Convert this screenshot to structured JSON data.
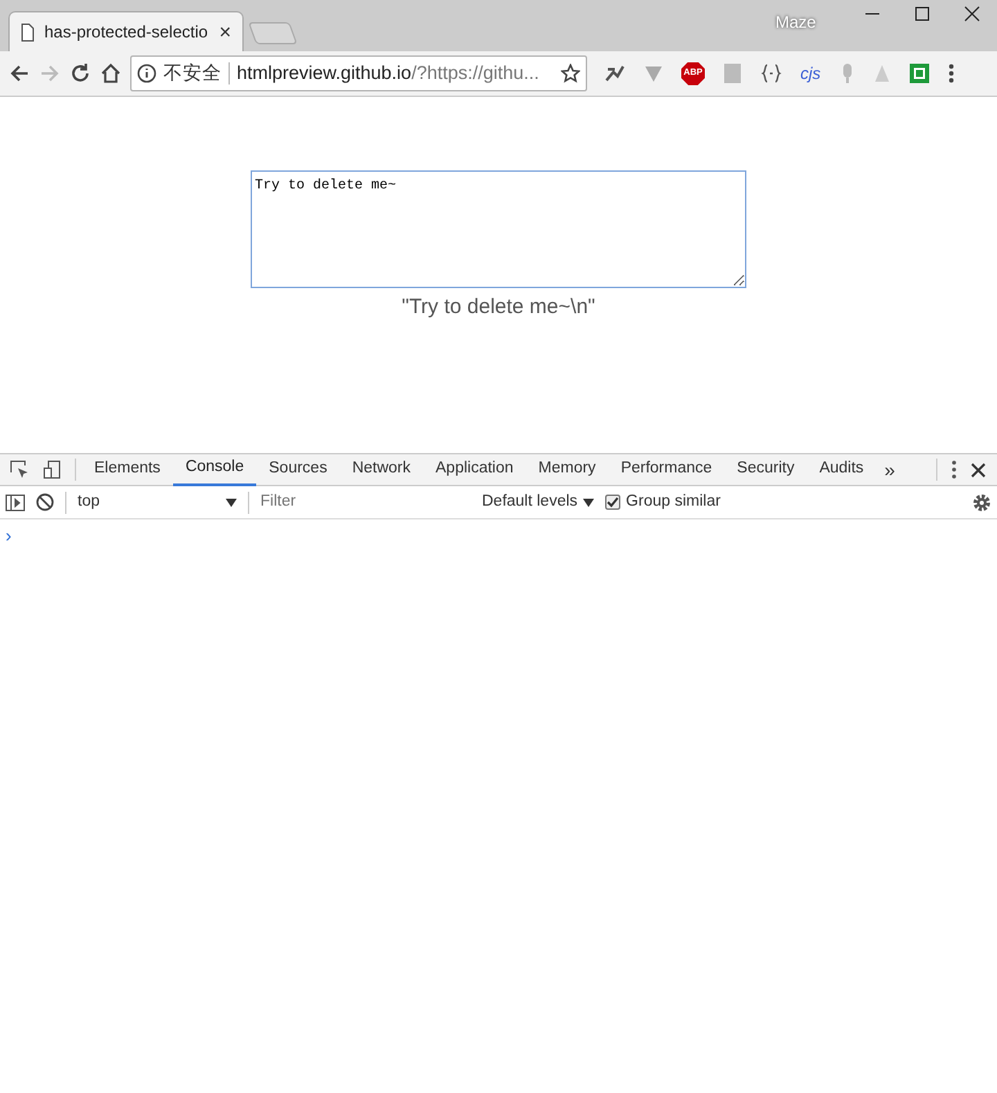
{
  "browser": {
    "tab": {
      "title": "has-protected-selectio",
      "close": "×"
    },
    "profile": "Maze",
    "address": {
      "security": "不安全",
      "host": "htmlpreview.github.io",
      "rest": "/?https://githu..."
    },
    "extension_labels": {
      "abp": "ABP",
      "cjs": "cjs"
    }
  },
  "page": {
    "textarea_value": "Try to delete me~\n",
    "caption": "\"Try to delete me~\\n\""
  },
  "devtools": {
    "tabs": [
      {
        "label": "Elements",
        "selected": false
      },
      {
        "label": "Console",
        "selected": true
      },
      {
        "label": "Sources",
        "selected": false
      },
      {
        "label": "Network",
        "selected": false
      },
      {
        "label": "Application",
        "selected": false
      },
      {
        "label": "Memory",
        "selected": false
      },
      {
        "label": "Performance",
        "selected": false
      },
      {
        "label": "Security",
        "selected": false
      },
      {
        "label": "Audits",
        "selected": false
      }
    ],
    "more": "»",
    "context": "top",
    "filter_placeholder": "Filter",
    "levels": "Default levels",
    "group_similar": {
      "label": "Group similar",
      "checked": true
    },
    "prompt": "›"
  }
}
